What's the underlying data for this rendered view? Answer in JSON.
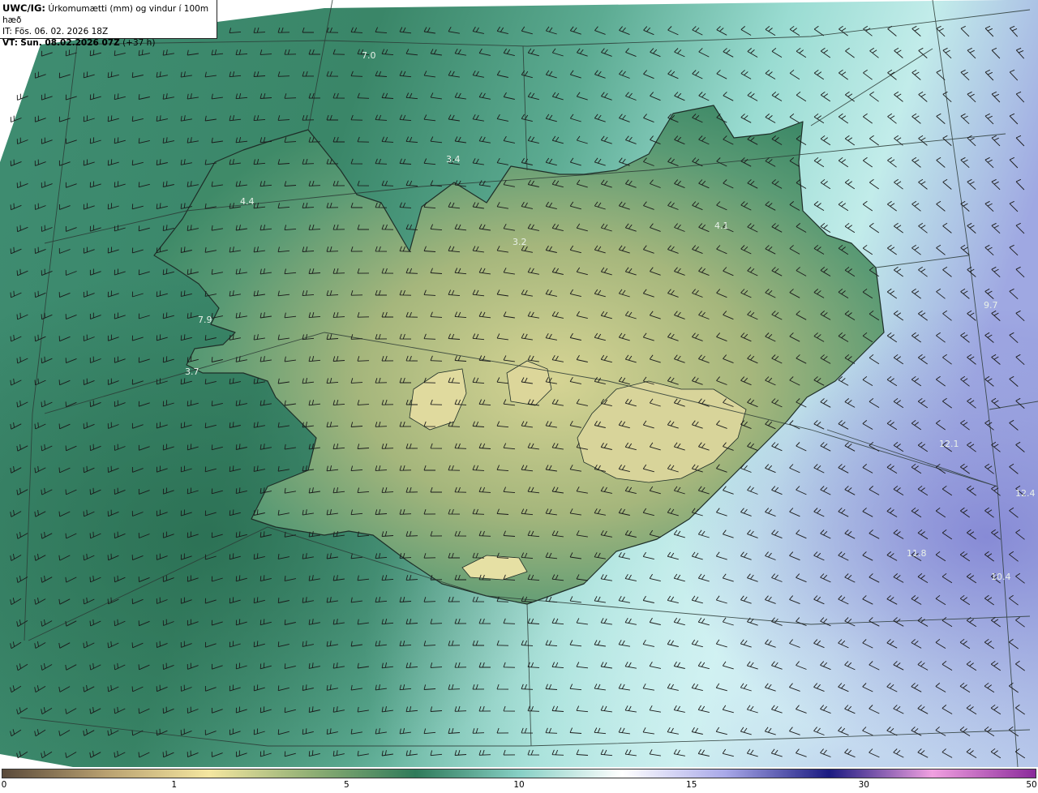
{
  "header": {
    "model_label": "UWC/IG:",
    "description": "Úrkomumætti (mm) og vindur í 100m hæð",
    "issue_time": "IT: Fös. 06. 02. 2026 18Z",
    "valid_prefix": "VT:",
    "valid_time": "Sun. 08.02.2026 07Z",
    "lead_time": "(+37 h)"
  },
  "colorbar": {
    "ticks": [
      {
        "label": "0",
        "pos": 0.0
      },
      {
        "label": "1",
        "pos": 0.1667
      },
      {
        "label": "5",
        "pos": 0.3333
      },
      {
        "label": "10",
        "pos": 0.5
      },
      {
        "label": "15",
        "pos": 0.6667
      },
      {
        "label": "30",
        "pos": 0.8333
      },
      {
        "label": "50",
        "pos": 1.0
      }
    ],
    "colors": [
      "#5a4a3a",
      "#b8a070",
      "#f4e6a0",
      "#8fae74",
      "#2f7a5a",
      "#86cfc4",
      "#ffffff",
      "#a8a8e8",
      "#1a1a80",
      "#f0a0e0",
      "#8a2a9a"
    ]
  },
  "map_labels": [
    {
      "text": "7.0"
    },
    {
      "text": "4.4"
    },
    {
      "text": "7.9"
    },
    {
      "text": "3.7"
    },
    {
      "text": "3.2"
    },
    {
      "text": "4.1"
    },
    {
      "text": "12.1"
    },
    {
      "text": "12.4"
    },
    {
      "text": "11.8"
    },
    {
      "text": "10.4"
    },
    {
      "text": "9.7"
    },
    {
      "text": "3.4"
    }
  ],
  "colors": {
    "ocean_green": "#3e8a6e",
    "ocean_light": "#9fdcd2",
    "land_yellow": "#c8c58a",
    "purple_east": "#8a8ad8"
  }
}
